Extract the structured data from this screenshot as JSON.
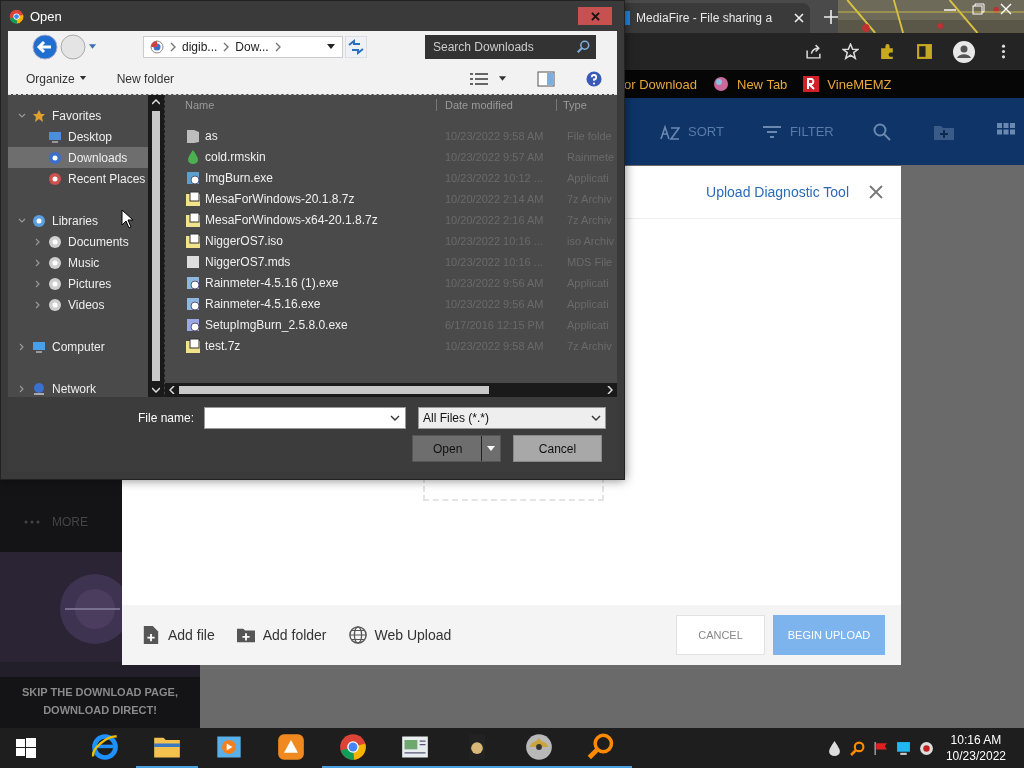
{
  "browser": {
    "tab": {
      "title": "MediaFire - File sharing a"
    },
    "bookmarks": [
      {
        "label": "or Download",
        "kind": "none"
      },
      {
        "label": "New Tab",
        "kind": "globe"
      },
      {
        "label": "VineMEMZ",
        "kind": "r"
      }
    ],
    "tools": [
      {
        "label": "SORT",
        "kind": "sort"
      },
      {
        "label": "FILTER",
        "kind": "filter"
      }
    ],
    "sidebar": {
      "more": "MORE",
      "promo": "SKIP THE DOWNLOAD PAGE, DOWNLOAD DIRECT!"
    },
    "modal": {
      "title": "Upload Diagnostic Tool",
      "actions": [
        {
          "label": "Add file",
          "kind": "file"
        },
        {
          "label": "Add folder",
          "kind": "folder"
        },
        {
          "label": "Web Upload",
          "kind": "web"
        }
      ],
      "cancel": "CANCEL",
      "begin": {
        "label": "BEGIN UPLOAD",
        "disabled": true
      }
    }
  },
  "dialog": {
    "title": "Open",
    "address": [
      "digib...",
      "Dow..."
    ],
    "search": {
      "placeholder": "Search Downloads"
    },
    "commands": [
      "Organize",
      "New folder"
    ],
    "nav": [
      {
        "label": "Favorites",
        "kind": "star",
        "expanded": true,
        "selected": false,
        "children": [
          {
            "label": "Desktop",
            "kind": "desktop",
            "selected": false
          },
          {
            "label": "Downloads",
            "kind": "downloads",
            "selected": true
          },
          {
            "label": "Recent Places",
            "kind": "recent",
            "selected": false
          }
        ]
      },
      {
        "label": "Libraries",
        "kind": "library",
        "expanded": true,
        "selected": false,
        "children": [
          {
            "label": "Documents",
            "kind": "lib",
            "expanded": false,
            "selected": false
          },
          {
            "label": "Music",
            "kind": "lib",
            "expanded": false,
            "selected": false
          },
          {
            "label": "Pictures",
            "kind": "lib",
            "expanded": false,
            "selected": false
          },
          {
            "label": "Videos",
            "kind": "lib",
            "expanded": false,
            "selected": false
          }
        ]
      },
      {
        "label": "Computer",
        "kind": "computer",
        "expanded": false,
        "selected": false
      },
      {
        "label": "Network",
        "kind": "network",
        "expanded": false,
        "selected": false
      }
    ],
    "columns": [
      "Name",
      "Date modified",
      "Type"
    ],
    "files": [
      {
        "name": "as",
        "kind": "folder",
        "date": "10/23/2022 9:58 AM",
        "type": "File folde"
      },
      {
        "name": "cold.rmskin",
        "kind": "skin",
        "date": "10/23/2022 9:57 AM",
        "type": "Rainmete"
      },
      {
        "name": "ImgBurn.exe",
        "kind": "app",
        "date": "10/23/2022 10:12 ...",
        "type": "Applicati"
      },
      {
        "name": "MesaForWindows-20.1.8.7z",
        "kind": "archive",
        "date": "10/20/2022 2:14 AM",
        "type": "7z Archiv"
      },
      {
        "name": "MesaForWindows-x64-20.1.8.7z",
        "kind": "archive",
        "date": "10/20/2022 2:16 AM",
        "type": "7z Archiv"
      },
      {
        "name": "NiggerOS7.iso",
        "kind": "iso",
        "date": "10/23/2022 10:16 ...",
        "type": "iso Archiv"
      },
      {
        "name": "NiggerOS7.mds",
        "kind": "file",
        "date": "10/23/2022 10:16 ...",
        "type": "MDS File"
      },
      {
        "name": "Rainmeter-4.5.16 (1).exe",
        "kind": "installer",
        "date": "10/23/2022 9:56 AM",
        "type": "Applicati"
      },
      {
        "name": "Rainmeter-4.5.16.exe",
        "kind": "installer",
        "date": "10/23/2022 9:56 AM",
        "type": "Applicati"
      },
      {
        "name": "SetupImgBurn_2.5.8.0.exe",
        "kind": "setup",
        "date": "6/17/2016 12:15 PM",
        "type": "Applicati"
      },
      {
        "name": "test.7z",
        "kind": "archive",
        "date": "10/23/2022 9:58 AM",
        "type": "7z Archiv"
      }
    ],
    "file_name_label": "File name:",
    "filter": "All Files (*.*)",
    "open": "Open",
    "cancel": "Cancel"
  },
  "taskbar": {
    "apps": [
      {
        "kind": "ie",
        "running": false
      },
      {
        "kind": "explorer",
        "running": true
      },
      {
        "kind": "player",
        "running": false
      },
      {
        "kind": "fox",
        "running": false
      },
      {
        "kind": "chrome",
        "running": true
      },
      {
        "kind": "doc",
        "running": true
      },
      {
        "kind": "card",
        "running": true
      },
      {
        "kind": "disc",
        "running": true
      },
      {
        "kind": "magnifier",
        "running": true
      }
    ],
    "time": "10:16 AM",
    "date": "10/23/2022"
  }
}
